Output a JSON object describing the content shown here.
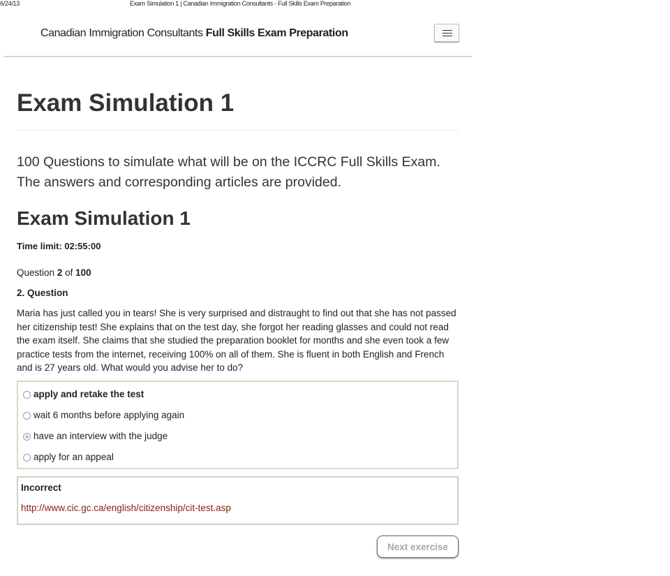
{
  "print_header": {
    "date": "6/24/13",
    "title": "Exam Simulation 1 | Canadian Immigration Consultants - Full Skills Exam Preparation"
  },
  "navbar": {
    "brand_regular": "Canadian Immigration Consultants",
    "brand_bold": "Full Skills Exam Preparation",
    "menu_icon": "hamburger-icon"
  },
  "page": {
    "title": "Exam Simulation 1",
    "intro": "100 Questions to simulate what will be on the ICCRC Full Skills Exam. The answers and corresponding articles are provided.",
    "subtitle": "Exam Simulation 1",
    "time_limit": "Time limit: 02:55:00"
  },
  "question": {
    "counter_prefix": "Question",
    "current": "2",
    "counter_of": "of",
    "total": "100",
    "heading": "2. Question",
    "text": "Maria has just called you in tears! She is very surprised and distraught to find out that she has not passed her citizenship test! She explains that on the test day, she forgot her reading glasses and could not read the exam itself. She claims that she studied the preparation booklet for months and she even took a few practice tests from the internet, receiving 100% on all of them. She is fluent in both English and French and is 27 years old. What would you advise her to do?",
    "answers": [
      {
        "label": "apply and retake the test",
        "checked": false,
        "correct": true
      },
      {
        "label": "wait 6 months before applying again",
        "checked": false,
        "correct": false
      },
      {
        "label": "have an interview with the judge",
        "checked": true,
        "correct": false
      },
      {
        "label": "apply for an appeal",
        "checked": false,
        "correct": false
      }
    ]
  },
  "feedback": {
    "result": "Incorrect",
    "link": "http://www.cic.gc.ca/english/citizenship/cit-test.asp"
  },
  "actions": {
    "next_label": "Next exercise"
  },
  "colors": {
    "link": "#8b1a10",
    "answers_border": "#d3dcc0",
    "feedback_border": "#cfcfcf",
    "button_text": "#a8a8a8"
  }
}
